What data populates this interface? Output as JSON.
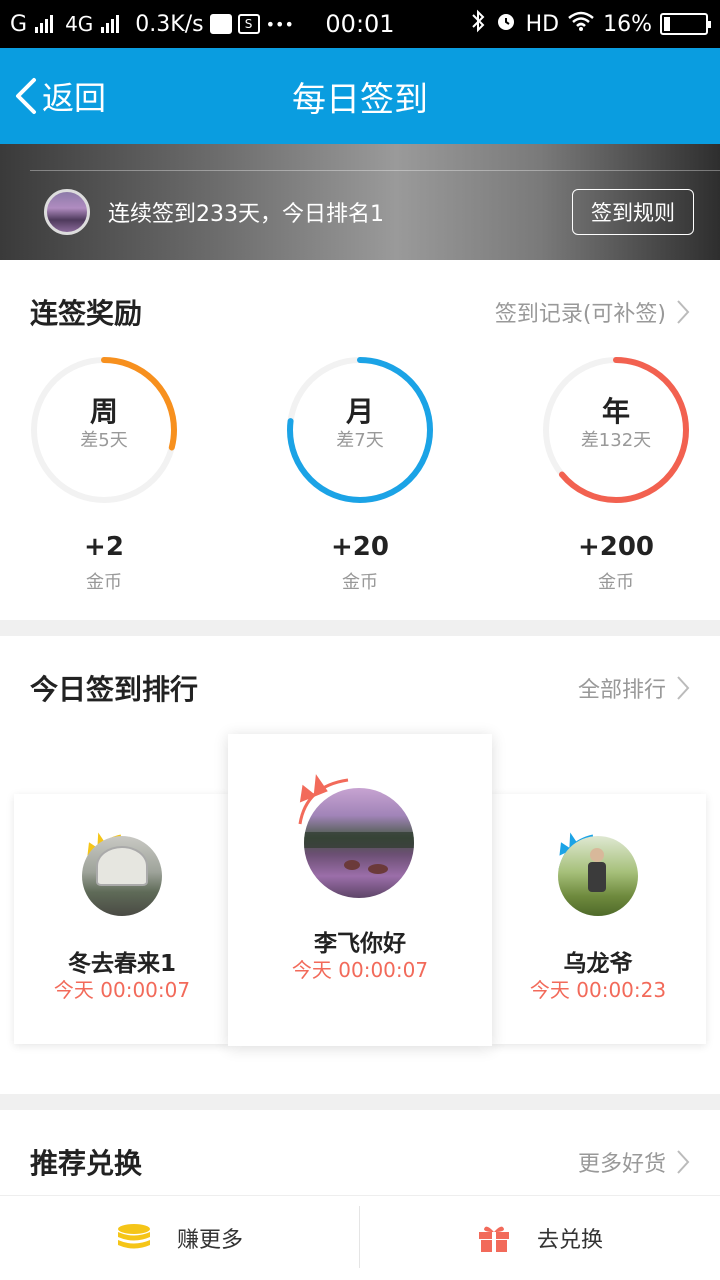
{
  "status_bar": {
    "carrier1": "G",
    "carrier2": "4G",
    "speed": "0.3K/s",
    "sim_badge": "S",
    "dots": "•••",
    "time": "00:01",
    "hd": "HD",
    "battery": "16%",
    "battery_level": 0.16
  },
  "header": {
    "back_label": "返回",
    "title": "每日签到"
  },
  "banner": {
    "streak_text": "连续签到233天，今日排名1",
    "rules_button": "签到规则"
  },
  "streak_rewards": {
    "title": "连签奖励",
    "link": "签到记录(可补签)",
    "rings": [
      {
        "label": "周",
        "remaining": "差5天",
        "reward": "+2",
        "unit": "金币",
        "progress": 0.29,
        "color": "#f7901e"
      },
      {
        "label": "月",
        "remaining": "差7天",
        "reward": "+20",
        "unit": "金币",
        "progress": 0.77,
        "color": "#1ba3e6"
      },
      {
        "label": "年",
        "remaining": "差132天",
        "reward": "+200",
        "unit": "金币",
        "progress": 0.64,
        "color": "#f26150"
      }
    ]
  },
  "ranking": {
    "title": "今日签到排行",
    "link": "全部排行",
    "entries": [
      {
        "name": "冬去春来1",
        "time": "今天 00:00:07",
        "crown_color": "#f5c518"
      },
      {
        "name": "李飞你好",
        "time": "今天 00:00:07",
        "crown_color": "#f26a5a"
      },
      {
        "name": "乌龙爷",
        "time": "今天 00:00:23",
        "crown_color": "#1ba3e6"
      }
    ]
  },
  "recommend": {
    "title": "推荐兑换",
    "link": "更多好货"
  },
  "bottom_bar": {
    "earn_label": "赚更多",
    "exchange_label": "去兑换",
    "earn_icon": "coin-stack-icon",
    "exchange_icon": "gift-icon"
  }
}
